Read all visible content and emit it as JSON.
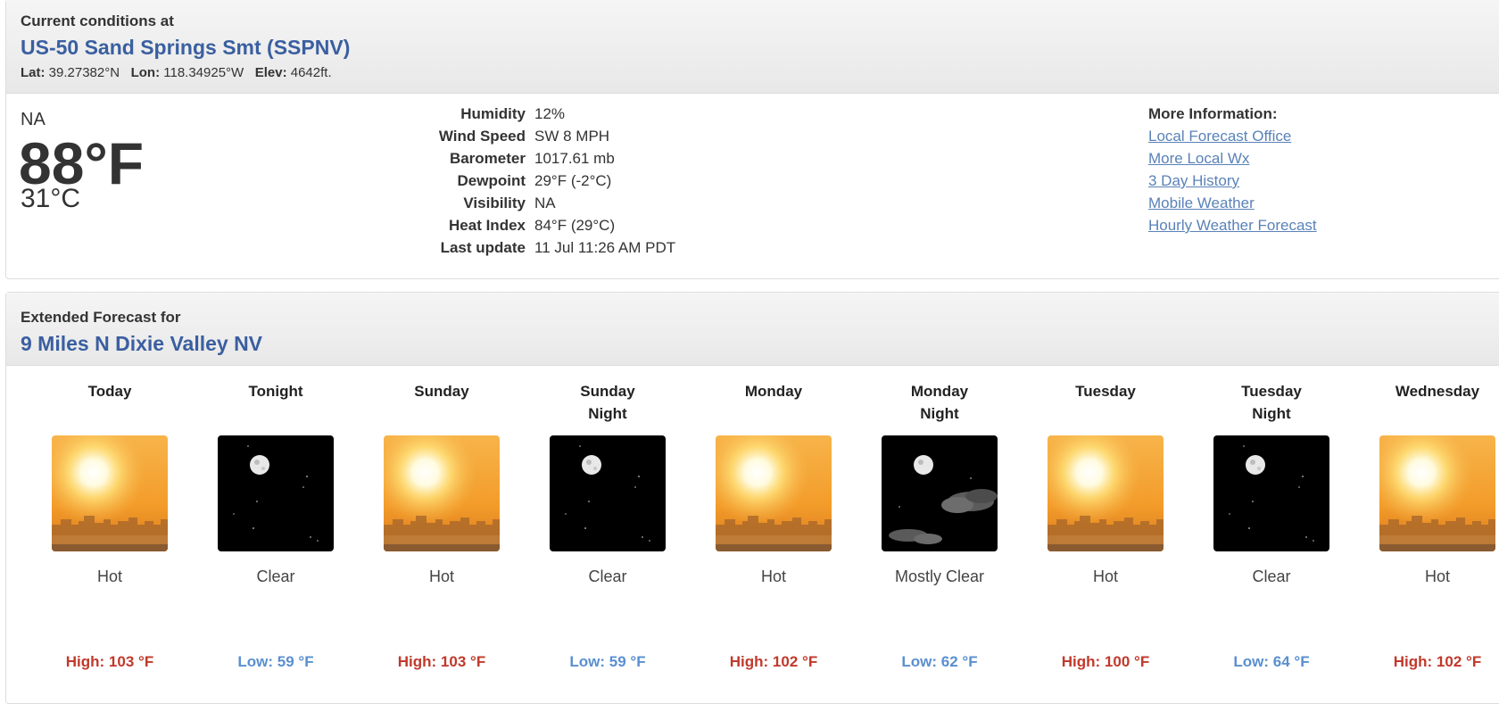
{
  "current": {
    "header_label": "Current conditions at",
    "station_name": "US-50 Sand Springs Smt (SSPNV)",
    "lat_label": "Lat:",
    "lat_value": "39.27382°N",
    "lon_label": "Lon:",
    "lon_value": "118.34925°W",
    "elev_label": "Elev:",
    "elev_value": "4642ft.",
    "condition": "NA",
    "temp_f": "88°F",
    "temp_c": "31°C",
    "details": [
      {
        "label": "Humidity",
        "value": "12%"
      },
      {
        "label": "Wind Speed",
        "value": "SW 8 MPH"
      },
      {
        "label": "Barometer",
        "value": "1017.61 mb"
      },
      {
        "label": "Dewpoint",
        "value": "29°F (-2°C)"
      },
      {
        "label": "Visibility",
        "value": "NA"
      },
      {
        "label": "Heat Index",
        "value": "84°F (29°C)"
      },
      {
        "label": "Last update",
        "value": "11 Jul 11:26 AM PDT"
      }
    ],
    "more_info_title": "More Information:",
    "links": [
      "Local Forecast Office",
      "More Local Wx",
      "3 Day History",
      "Mobile Weather",
      "Hourly Weather Forecast"
    ]
  },
  "extended": {
    "header_label": "Extended Forecast for",
    "location": "9 Miles N Dixie Valley NV",
    "periods": [
      {
        "name_line1": "Today",
        "name_line2": "",
        "icon": "hot-sun-icon",
        "desc": "Hot",
        "temp": "High: 103 °F",
        "kind": "high"
      },
      {
        "name_line1": "Tonight",
        "name_line2": "",
        "icon": "clear-night-icon",
        "desc": "Clear",
        "temp": "Low: 59 °F",
        "kind": "low"
      },
      {
        "name_line1": "Sunday",
        "name_line2": "",
        "icon": "hot-sun-icon",
        "desc": "Hot",
        "temp": "High: 103 °F",
        "kind": "high"
      },
      {
        "name_line1": "Sunday",
        "name_line2": "Night",
        "icon": "clear-night-icon",
        "desc": "Clear",
        "temp": "Low: 59 °F",
        "kind": "low"
      },
      {
        "name_line1": "Monday",
        "name_line2": "",
        "icon": "hot-sun-icon",
        "desc": "Hot",
        "temp": "High: 102 °F",
        "kind": "high"
      },
      {
        "name_line1": "Monday",
        "name_line2": "Night",
        "icon": "mostly-clear-night-icon",
        "desc": "Mostly Clear",
        "temp": "Low: 62 °F",
        "kind": "low"
      },
      {
        "name_line1": "Tuesday",
        "name_line2": "",
        "icon": "hot-sun-icon",
        "desc": "Hot",
        "temp": "High: 100 °F",
        "kind": "high"
      },
      {
        "name_line1": "Tuesday",
        "name_line2": "Night",
        "icon": "clear-night-icon",
        "desc": "Clear",
        "temp": "Low: 64 °F",
        "kind": "low"
      },
      {
        "name_line1": "Wednesday",
        "name_line2": "",
        "icon": "hot-sun-icon",
        "desc": "Hot",
        "temp": "High: 102 °F",
        "kind": "high"
      }
    ]
  },
  "colors": {
    "station_title": "#3a5fa0",
    "link": "#5a82b8",
    "high_temp": "#c0392b",
    "low_temp": "#5a8fd0"
  }
}
